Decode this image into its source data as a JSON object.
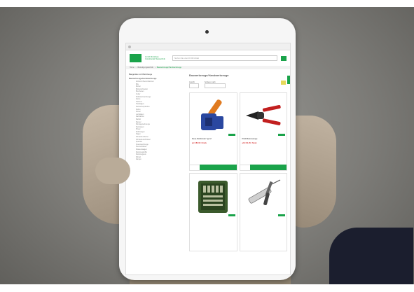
{
  "tablet_screen": {
    "header": {
      "logo_text": "Anrich Rinckhaus Grosshandel Haustechnik",
      "search_placeholder": "Suchen Sie unter 20 000 Artikel"
    },
    "breadcrumb": {
      "items": [
        "Home",
        "Befestigungstechnik",
        "Bauwerkzeuge/Handwerkzeuge"
      ]
    },
    "sidebar": {
      "categories": [
        "Baugeräte und Werkzeuge",
        "Bauwerkzeuge/Handwerkzeuge"
      ],
      "items": [
        "Abbruch-/Stemmhämmer",
        "Bits",
        "Bohrer",
        "Bolzenschneider",
        "Brecheisen",
        "Cutter",
        "Dübelsetzwerkzeuge",
        "Feilen",
        "Hammer",
        "Handsägen",
        "Kartuschenpistolen",
        "Kellen",
        "Körner",
        "Lochsägen",
        "Maßbänder",
        "Meißel",
        "Messer",
        "Montagewerkzeuge",
        "Nietzangen",
        "Pinsel",
        "Rohrzangen",
        "Sägen",
        "Schraubendreher",
        "Schraubenschlüssel",
        "Spachtel",
        "Spannwerkzeuge",
        "Steckschlüssel",
        "Wasserwaagen",
        "Werkzeugkoffer",
        "Werkzeugsets",
        "Winkel",
        "Zangen"
      ]
    },
    "main": {
      "title": "Bauwerkzeuge/Handwerkzeuge",
      "controls": [
        "Ansicht",
        "Sortieren nach"
      ],
      "products": [
        {
          "name": "Flexa Rohrbinder Typ M",
          "price": "ab € 89,95 / Stück"
        },
        {
          "name": "PGW Bolzenzange",
          "price": "ab € 84,95 / Stück"
        },
        {
          "name": "",
          "price": ""
        },
        {
          "name": "",
          "price": ""
        }
      ]
    }
  },
  "colors": {
    "brand_green": "#1aa34a"
  }
}
